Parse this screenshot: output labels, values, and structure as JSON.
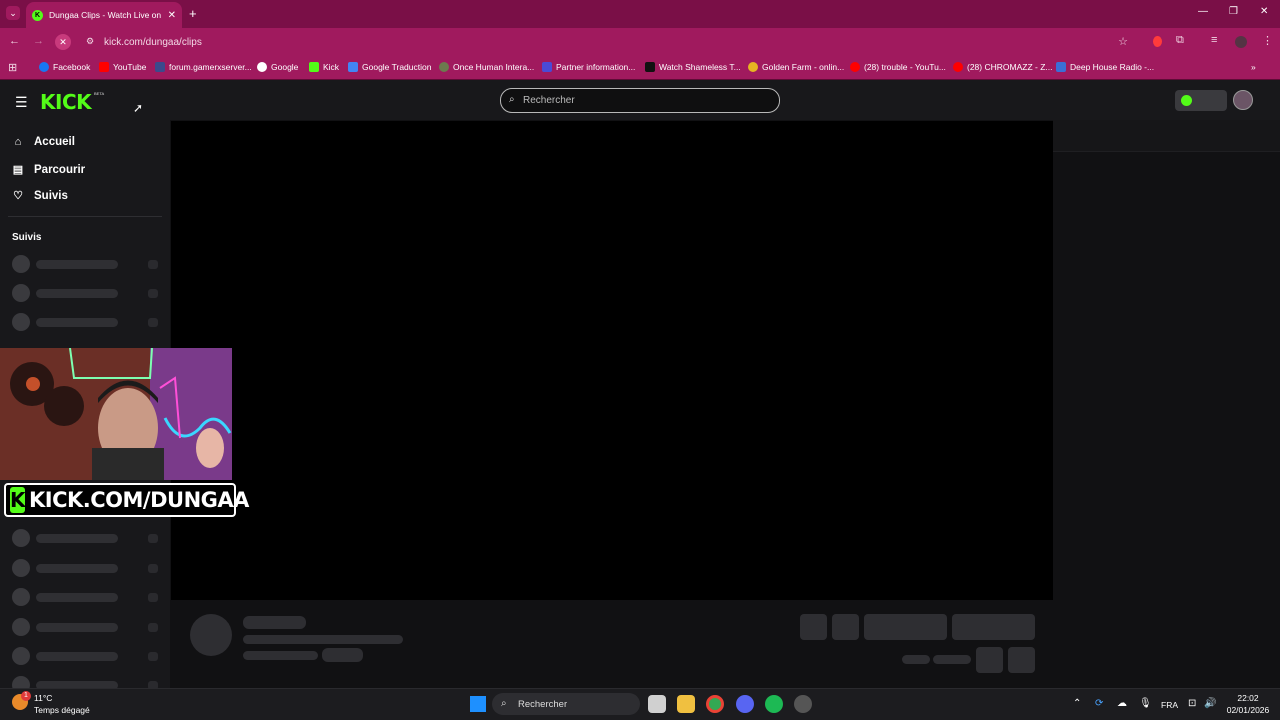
{
  "browser": {
    "tab_title": "Dungaa Clips - Watch Live on K",
    "url": "kick.com/dungaa/clips",
    "bookmarks": [
      "Facebook",
      "YouTube",
      "forum.gamerxserver...",
      "Google",
      "Kick",
      "Google Traduction",
      "Once Human Intera...",
      "Partner information...",
      "Watch Shameless T...",
      "Golden Farm - onlin...",
      "(28) trouble - YouTu...",
      "(28) CHROMAZZ - Z...",
      "Deep House Radio -..."
    ],
    "overflow": "»"
  },
  "kick": {
    "logo": "KICK",
    "beta": "BETA",
    "search_placeholder": "Rechercher",
    "nav": {
      "home": "Accueil",
      "browse": "Parcourir",
      "following": "Suivis"
    },
    "section_following": "Suivis"
  },
  "overlay": {
    "text": "KICK.COM/DUNGAA",
    "k": "K"
  },
  "taskbar": {
    "weather_temp": "11°C",
    "weather_desc": "Temps dégagé",
    "search": "Rechercher",
    "lang": "FRA",
    "time": "22:02",
    "date": "02/01/2026",
    "weather_badge": "1"
  },
  "colors": {
    "kick_green": "#53fc18",
    "chrome_bg": "#a01a5e",
    "tab_strip": "#7a0f47"
  }
}
